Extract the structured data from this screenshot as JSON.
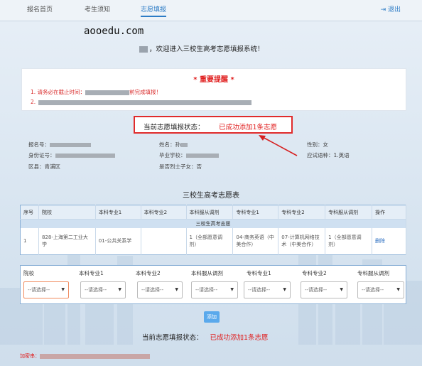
{
  "nav": {
    "tabs": [
      {
        "label": "报名首页"
      },
      {
        "label": "考生须知"
      },
      {
        "label": "志愿填报"
      }
    ],
    "logout": "退出"
  },
  "watermark": "aooedu.com",
  "welcome": "，欢迎进入三校生高考志愿填报系统！",
  "notice": {
    "title": "* 重要提醒 *",
    "line1_prefix": "1. 请务必在截止时间：",
    "line1_suffix": "前完成填报！",
    "line2_prefix": "2."
  },
  "status": {
    "label": "当前志愿填报状态：",
    "value": "已成功添加1条志愿"
  },
  "info": {
    "reg_label": "报名号：",
    "name_label": "姓名：",
    "name_value": "孙",
    "gender_label": "性别：",
    "gender_value": "女",
    "id_label": "身份证号：",
    "school_label": "毕业学校：",
    "exam_label": "应试语种：",
    "exam_value": "1.英语",
    "district_label": "区县：",
    "district_value": "青浦区",
    "martyr_label": "是否烈士子女：",
    "martyr_value": "否"
  },
  "table": {
    "title": "三校生高考志愿表",
    "headers": [
      "序号",
      "院校",
      "本科专业1",
      "本科专业2",
      "本科服从调剂",
      "专科专业1",
      "专科专业2",
      "专科服从调剂",
      "操作"
    ],
    "group_label": "三校生高考志愿",
    "rows": [
      {
        "no": "1",
        "school": "828-上海第二工业大学",
        "bk1": "01-公共关系学",
        "bk2": "",
        "bk_adjust": "1（全部愿意调剂）",
        "zk1": "04-商务英语（中美合作）",
        "zk2": "07-计算机网络技术（中美合作）",
        "zk_adjust": "1（全部愿意调剂）",
        "action": "删除"
      }
    ]
  },
  "form": {
    "labels": [
      "院校",
      "本科专业1",
      "本科专业2",
      "本科服从调剂",
      "专科专业1",
      "专科专业2",
      "专科服从调剂"
    ],
    "placeholder": "--请选择--"
  },
  "add_button": "添加",
  "bottom_status": {
    "label": "当前志愿填报状态：",
    "value": "已成功添加1条志愿"
  },
  "encrypted_label": "加密串："
}
